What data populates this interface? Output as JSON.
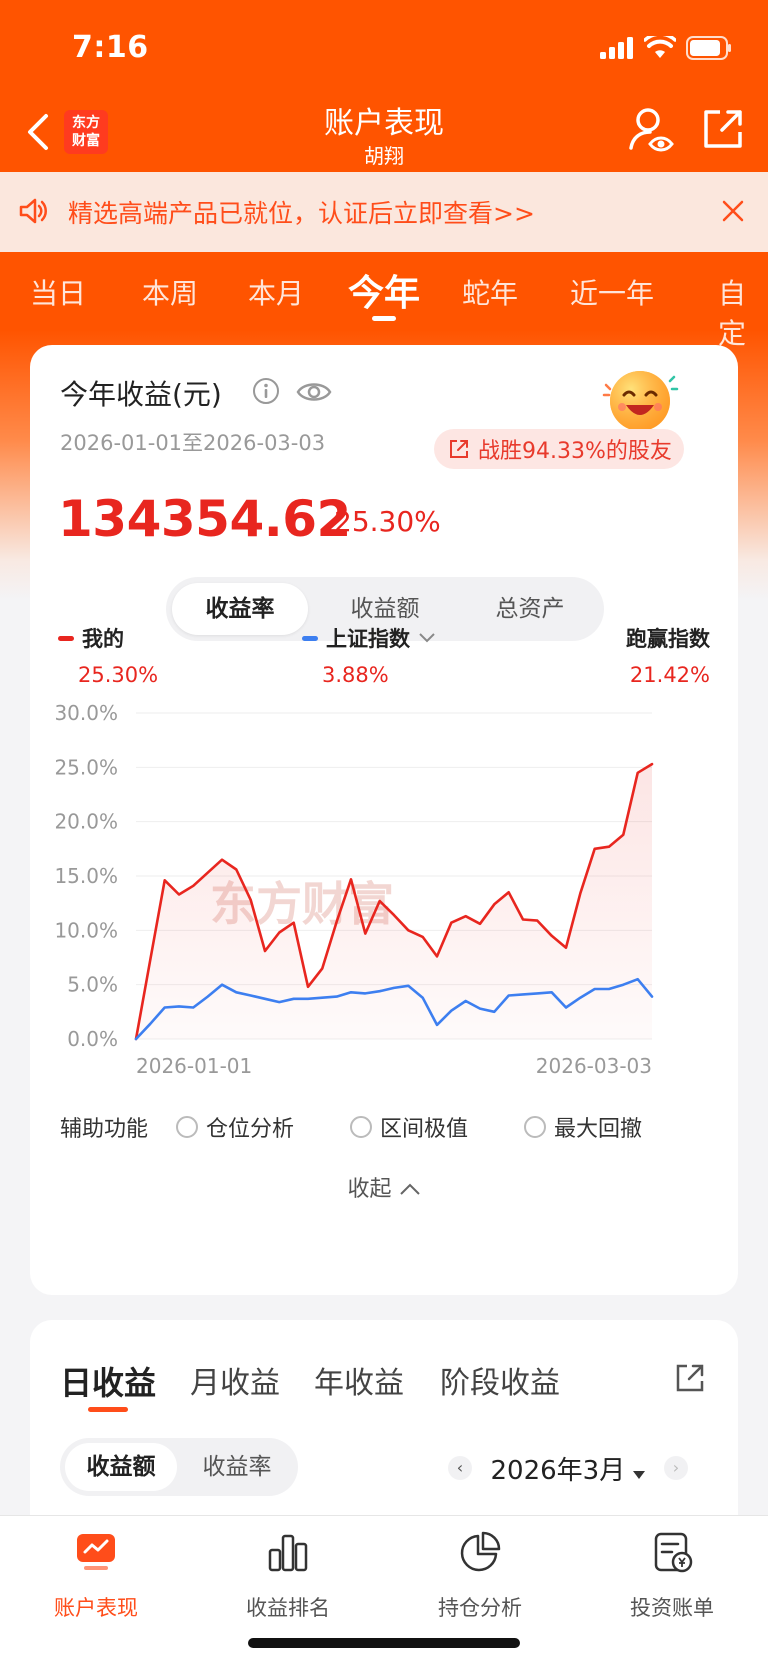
{
  "status_bar": {
    "time": "7:16"
  },
  "nav": {
    "logo_line1": "东方",
    "logo_line2": "财富",
    "title": "账户表现",
    "subtitle": "胡翔"
  },
  "notice": {
    "text": "精选高端产品已就位，认证后立即查看>>"
  },
  "period_tabs": [
    "当日",
    "本周",
    "本月",
    "今年",
    "蛇年",
    "近一年",
    "自定"
  ],
  "active_period": "今年",
  "summary": {
    "title": "今年收益(元)",
    "date_range": "2026-01-01至2026-03-03",
    "beat_text": "战胜94.33%的股友",
    "profit": "134354.62",
    "rate": "25.30%"
  },
  "metric_tabs": [
    "收益率",
    "收益额",
    "总资产"
  ],
  "legend": {
    "mine": {
      "label": "我的",
      "value": "25.30%"
    },
    "index": {
      "label": "上证指数",
      "value": "3.88%"
    },
    "beat": {
      "label": "跑赢指数",
      "value": "21.42%"
    }
  },
  "colors": {
    "brand": "#ff5400",
    "mine": "#e8261f",
    "index": "#3d7ff0"
  },
  "chart_data": {
    "type": "line",
    "x_start": "2026-01-01",
    "x_end": "2026-03-03",
    "x_tick_labels": [
      "2026-01-01",
      "2026-03-03"
    ],
    "y_tick_labels": [
      "30.0%",
      "25.0%",
      "20.0%",
      "15.0%",
      "10.0%",
      "5.0%",
      "0.0%"
    ],
    "ylim": [
      0,
      30
    ],
    "watermark": "东方财富",
    "series": [
      {
        "name": "我的",
        "values": [
          0,
          7.3,
          14.6,
          13.3,
          14.1,
          15.3,
          16.5,
          15.6,
          12.8,
          8.1,
          9.8,
          10.7,
          4.8,
          6.5,
          10.8,
          14.7,
          9.7,
          12.7,
          11.4,
          10.0,
          9.4,
          7.6,
          10.7,
          11.3,
          10.6,
          12.4,
          13.5,
          11.0,
          10.9,
          9.5,
          8.4,
          13.4,
          17.5,
          17.7,
          18.8,
          24.5,
          25.3
        ]
      },
      {
        "name": "上证指数",
        "values": [
          0,
          1.4,
          2.9,
          3.0,
          2.9,
          3.9,
          5.0,
          4.3,
          4.0,
          3.7,
          3.4,
          3.7,
          3.7,
          3.8,
          3.9,
          4.3,
          4.2,
          4.4,
          4.7,
          4.9,
          3.8,
          1.3,
          2.6,
          3.5,
          2.8,
          2.5,
          4.0,
          4.1,
          4.2,
          4.3,
          2.9,
          3.8,
          4.6,
          4.6,
          5.0,
          5.5,
          3.9
        ]
      }
    ]
  },
  "aux": {
    "label": "辅助功能",
    "options": [
      "仓位分析",
      "区间极值",
      "最大回撤"
    ]
  },
  "collapse_label": "收起",
  "earnings": {
    "tabs": [
      "日收益",
      "月收益",
      "年收益",
      "阶段收益"
    ],
    "segment": [
      "收益额",
      "收益率"
    ],
    "month": "2026年3月"
  },
  "bottom_nav": [
    "账户表现",
    "收益排名",
    "持仓分析",
    "投资账单"
  ]
}
